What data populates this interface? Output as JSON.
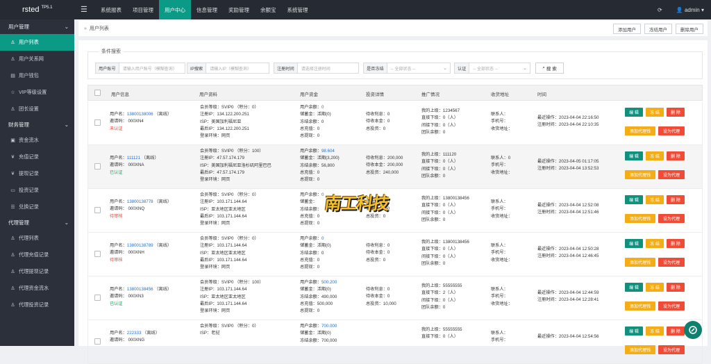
{
  "brand": {
    "name": "rsted",
    "version": "TP5.1"
  },
  "topnav": [
    "系统报表",
    "项目管理",
    "用户中心",
    "信息管理",
    "奖励管理",
    "余额宝",
    "系统管理"
  ],
  "top_right": {
    "refresh_icon": "refresh-icon",
    "user": "admin"
  },
  "sidebar": [
    {
      "group": "用户管理",
      "items": [
        {
          "label": "用户列表",
          "icon": "user-icon",
          "active": true
        },
        {
          "label": "用户关系网",
          "icon": "users-icon"
        },
        {
          "label": "用户钱包",
          "icon": "wallet-icon"
        },
        {
          "label": "VIP等级设置",
          "icon": "star-icon"
        },
        {
          "label": "团长设置",
          "icon": "user-icon"
        }
      ]
    },
    {
      "group": "财务管理",
      "items": [
        {
          "label": "资金流水",
          "icon": "money-icon"
        },
        {
          "label": "充值记录",
          "icon": "yen-icon"
        },
        {
          "label": "提现记录",
          "icon": "yen-icon"
        },
        {
          "label": "投资记录",
          "icon": "chat-icon"
        },
        {
          "label": "兑换记录",
          "icon": "list-icon"
        }
      ]
    },
    {
      "group": "代理管理",
      "items": [
        {
          "label": "代理列表",
          "icon": "user-icon"
        },
        {
          "label": "代理充值记录",
          "icon": "user-icon"
        },
        {
          "label": "代理提现记录",
          "icon": "user-icon"
        },
        {
          "label": "代理资金流水",
          "icon": "user-icon"
        },
        {
          "label": "代理投资记录",
          "icon": "user-icon"
        }
      ]
    }
  ],
  "breadcrumb": "用户列表",
  "actions": {
    "add": "添加用户",
    "freeze": "冻结用户",
    "delete": "删除用户"
  },
  "search": {
    "title": "条件搜索",
    "account_label": "用户账号",
    "account_placeholder": "请输入用户账号（模糊查询）",
    "ip_label": "IP搜索",
    "ip_placeholder": "请输入IP（模糊查询）",
    "time_label": "注册时间",
    "time_placeholder": "请选择注册时间",
    "frozen_label": "是否冻结",
    "frozen_value": "-- 全部状态 --",
    "auth_label": "认证",
    "auth_value": "-- 全部状态 --",
    "button": "搜 索"
  },
  "columns": [
    "用户信息",
    "用户资料",
    "用户资金",
    "投资详情",
    "推广情况",
    "收货地址",
    "时间"
  ],
  "buttons": {
    "edit": "编 辑",
    "freeze": "冻 结",
    "delete": "删 除",
    "set_agent": "设为代理"
  },
  "rows": [
    {
      "user_prefix": "用户名：",
      "phone": "13800138006",
      "online": "（离线）",
      "invite": "邀请码： 000XN4",
      "status": "未认证",
      "status_color": "#e84a3a",
      "info": [
        "会员等级：SVIP0 （积分：0）",
        "注册IP：134.122.200.251",
        "ISP：美国加利福尼亚",
        "最后IP：134.122.200.251",
        "登录环境：网页"
      ],
      "funds_label": "用户余额：",
      "funds_value": "0",
      "funds": [
        "储蓄金：活期(0)",
        "冻结余额：0",
        "总充值：0",
        "总提现：0"
      ],
      "invest": [
        "待收利息：0",
        "待收本金：0",
        "总投资：0"
      ],
      "promo": [
        "我的上级：1234567",
        "直接下级：0（人）",
        "间接下级：0（人）",
        "团队余额：0"
      ],
      "addr": [
        "联系人：",
        "手机号：",
        "收货地址："
      ],
      "time": [
        "最近操作：2023-04-04 22:16:50",
        "注册时间：2023-04-04 22:10:35"
      ],
      "alt": false
    },
    {
      "user_prefix": "用户名：",
      "phone": "111121",
      "online": "（离线）",
      "invite": "邀请码： 000XNA",
      "status": "已认证",
      "status_color": "#19a35a",
      "info": [
        "会员等级：SVIP0 （积分：100）",
        "注册IP：47.57.174.179",
        "ISP：美国加利福尼亚洛杉矶阿里巴巴",
        "最后IP：47.57.174.179",
        "登录环境：网页"
      ],
      "funds_label": "用户余额：",
      "funds_value": "98.604",
      "funds": [
        "储蓄金：活期(3,200)",
        "冻结余额：56,800",
        "总充值：0",
        "总提现：0"
      ],
      "invest": [
        "待收利息：200,000",
        "待收本金：200,000",
        "总投资：240,000"
      ],
      "promo": [
        "我的上级：111120",
        "直接下级：0（人）",
        "间接下级：0（人）",
        "团队余额：0"
      ],
      "addr": [
        "联系人：0",
        "手机号：",
        "收货地址："
      ],
      "time": [
        "最近操作：2023-04-05 01:17:05",
        "注册时间：2023-04-04 13:52:53"
      ],
      "alt": true
    },
    {
      "user_prefix": "用户名：",
      "phone": "13800138778",
      "online": "（离线）",
      "invite": "邀请码： 000XNQ",
      "status": "待审核",
      "status_color": "#e84a3a",
      "info": [
        "会员等级：SVIP0 （积分：0）",
        "注册IP：103.171.144.64",
        "ISP：亚太地区亚太地区",
        "最后IP：103.171.144.64",
        "登录环境：网页"
      ],
      "funds_label": "用户余额：",
      "funds_value": "0",
      "funds": [
        "储蓄金：",
        "冻结余额：",
        "总充值：0",
        "总提现：0"
      ],
      "invest": [
        "待收利息：0",
        "待收本金：0",
        "总投资：0"
      ],
      "promo": [
        "我的上级：13800138456",
        "直接下级：0（人）",
        "间接下级：0（人）",
        "团队余额：0"
      ],
      "addr": [
        "联系人：",
        "手机号：",
        "收货地址："
      ],
      "time": [
        "最近操作：2023-04-04 12:52:08",
        "注册时间：2023-04-04 12:51:46"
      ],
      "alt": false
    },
    {
      "user_prefix": "用户名：",
      "phone": "13800138789",
      "online": "（离线）",
      "invite": "邀请码： 000XNH",
      "status": "待审核",
      "status_color": "#e84a3a",
      "info": [
        "会员等级：SVIP0 （积分：0）",
        "注册IP：103.171.144.64",
        "ISP：亚太地区亚太地区",
        "最后IP：103.171.144.64",
        "登录环境：网页"
      ],
      "funds_label": "用户余额：",
      "funds_value": "0",
      "funds": [
        "储蓄金：活期(0)",
        "冻结余额：0",
        "总充值：0",
        "总提现：0"
      ],
      "invest": [
        "待收利息：0",
        "待收本金：0",
        "总投资：0"
      ],
      "promo": [
        "我的上级：13800138456",
        "直接下级：0（人）",
        "间接下级：0（人）",
        "团队余额：0"
      ],
      "addr": [
        "联系人：",
        "手机号：",
        "收货地址："
      ],
      "time": [
        "最近操作：2023-04-04 12:50:28",
        "注册时间：2023-04-04 12:46:45"
      ],
      "alt": false
    },
    {
      "user_prefix": "用户名：",
      "phone": "13800138456",
      "online": "（离线）",
      "invite": "邀请码： 000XN3",
      "status": "已认证",
      "status_color": "#19a35a",
      "info": [
        "会员等级：SVIP0 （积分：100）",
        "注册IP：103.171.144.64",
        "ISP：亚太地区亚太地区",
        "最后IP：103.171.144.64",
        "登录环境：网页"
      ],
      "funds_label": "用户余额：",
      "funds_value": "500.200",
      "funds": [
        "储蓄金：活期(0)",
        "冻结余额：490,000",
        "总充值：500,000",
        "总提现：0"
      ],
      "invest": [
        "待收利息：0",
        "待收本金：0",
        "总投资：10,000"
      ],
      "promo": [
        "我的上级：55555555",
        "直接下级：2（人）",
        "间接下级：0（人）",
        "团队余额：0"
      ],
      "addr": [
        "联系人：",
        "手机号：",
        "收货地址："
      ],
      "time": [
        "最近操作：2023-04-04 12:44:59",
        "注册时间：2023-04-04 12:28:41"
      ],
      "alt": false
    },
    {
      "user_prefix": "用户名：",
      "phone": "222333",
      "online": "（离线）",
      "invite": "邀请码： 000XNG",
      "status": "",
      "status_color": "#19a35a",
      "info": [
        "会员等级：SVIP0 （积分：0）",
        "ISP：老挝",
        "",
        "",
        ""
      ],
      "funds_label": "用户余额：",
      "funds_value": "700.000",
      "funds": [
        "储蓄金：活期(0)",
        "冻结余额：700,000",
        "",
        ""
      ],
      "invest": [
        "",
        "",
        ""
      ],
      "promo": [
        "我的上级：55555555",
        "直接下级：0（人）",
        "",
        ""
      ],
      "addr": [
        "联系人：",
        "手机号：",
        ""
      ],
      "time": [
        "最近操作：2023-04-04 12:54:56",
        "",
        ""
      ],
      "alt": false
    }
  ],
  "watermark": "南工科技",
  "chat_icon": "chat-bubble-icon",
  "colors": {
    "topbar": "#252a33",
    "sidebar": "#2b303b",
    "accent": "#0a9a86",
    "edit": "#12907e",
    "freeze": "#f5ad16",
    "delete": "#f04b36"
  }
}
